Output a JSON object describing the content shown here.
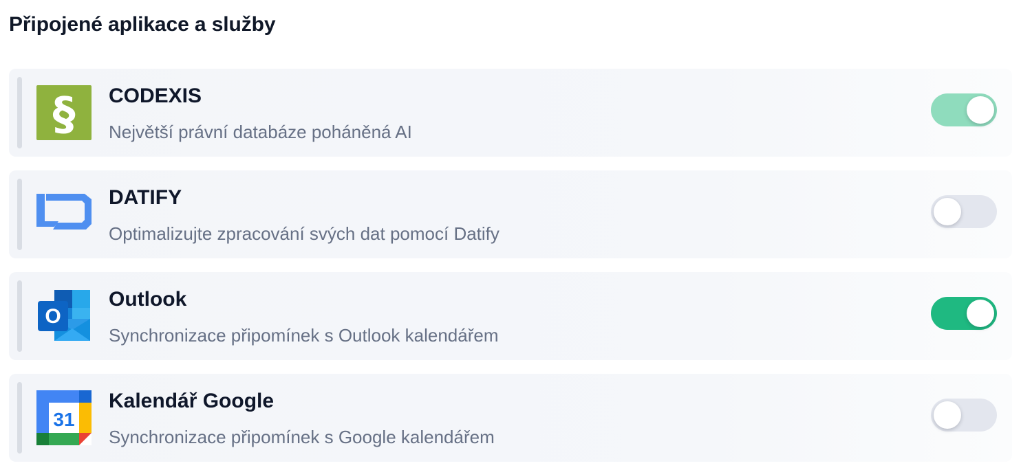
{
  "page": {
    "title": "Připojené aplikace a služby"
  },
  "apps": [
    {
      "name": "CODEXIS",
      "description": "Největší právní databáze poháněná AI",
      "icon": "codexis-paragraph-icon",
      "enabled": true,
      "toggle_color": "#8fdcbd"
    },
    {
      "name": "DATIFY",
      "description": "Optimalizujte zpracování svých dat pomocí Datify",
      "icon": "datify-logo-icon",
      "enabled": false,
      "toggle_color": "#e3e6ee"
    },
    {
      "name": "Outlook",
      "description": "Synchronizace připomínek s Outlook kalendářem",
      "icon": "outlook-icon",
      "enabled": true,
      "toggle_color": "#1fb981"
    },
    {
      "name": "Kalendář Google",
      "description": "Synchronizace připomínek s Google kalendářem",
      "icon": "google-calendar-icon",
      "icon_text": "31",
      "enabled": false,
      "toggle_color": "#e3e6ee"
    }
  ]
}
